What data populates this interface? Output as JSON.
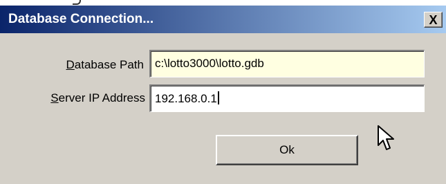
{
  "window": {
    "title": "Database Connection...",
    "close_label": "X"
  },
  "form": {
    "path": {
      "label_mnemonic": "D",
      "label_rest": "atabase Path",
      "value": "c:\\lotto3000\\lotto.gdb"
    },
    "ip": {
      "label_mnemonic": "S",
      "label_rest": "erver IP Address",
      "value": "192.168.0.1"
    },
    "ok_label": "Ok"
  },
  "colors": {
    "titlebar_start": "#0a246a",
    "titlebar_end": "#a6caf0",
    "dialog_bg": "#d4d0c8",
    "path_field_bg": "#ffffe1"
  },
  "icons": [
    "close-icon",
    "mouse-pointer-icon"
  ]
}
